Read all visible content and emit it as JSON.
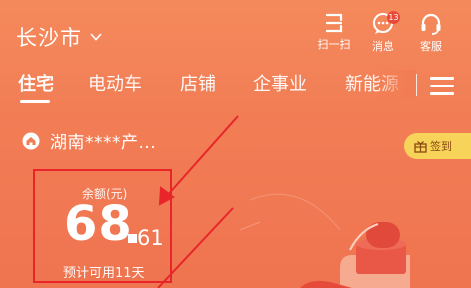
{
  "header": {
    "city": "长沙市",
    "buttons": [
      {
        "label": "扫一扫",
        "icon": "scan-icon"
      },
      {
        "label": "消息",
        "icon": "message-icon",
        "badge": "13"
      },
      {
        "label": "客服",
        "icon": "headset-icon"
      }
    ]
  },
  "tabs": [
    {
      "label": "住宅",
      "active": true
    },
    {
      "label": "电动车",
      "active": false
    },
    {
      "label": "店铺",
      "active": false
    },
    {
      "label": "企事业",
      "active": false
    },
    {
      "label": "新能源",
      "active": false
    }
  ],
  "account": {
    "name": "湖南****产...",
    "icon": "home-icon"
  },
  "sign_in": {
    "label": "签到",
    "icon": "gift-icon"
  },
  "balance": {
    "label": "余额(元)",
    "integer": "68",
    "decimal": "61",
    "estimate": "预计可用11天"
  },
  "colors": {
    "background": "#f27d55",
    "annotation": "#e8262a",
    "sign_bg": "#f7d35a"
  }
}
